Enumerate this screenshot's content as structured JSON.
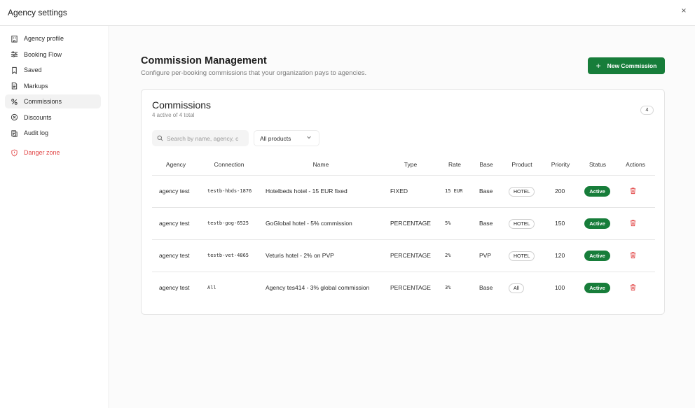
{
  "window": {
    "title": "Agency settings",
    "close_label": "×"
  },
  "sidebar": {
    "items": [
      {
        "label": "Agency profile",
        "icon": "building-icon"
      },
      {
        "label": "Booking Flow",
        "icon": "sliders-icon"
      },
      {
        "label": "Saved",
        "icon": "bookmark-icon"
      },
      {
        "label": "Markups",
        "icon": "document-icon"
      },
      {
        "label": "Commissions",
        "icon": "handshake-icon",
        "active": true
      },
      {
        "label": "Discounts",
        "icon": "circle-x-icon"
      },
      {
        "label": "Audit log",
        "icon": "log-icon"
      }
    ],
    "danger": {
      "label": "Danger zone",
      "icon": "shield-icon"
    }
  },
  "header": {
    "title": "Commission Management",
    "subtitle": "Configure per-booking commissions that your organization pays to agencies.",
    "new_button": "New Commission",
    "new_button_icon": "+"
  },
  "card": {
    "title": "Commissions",
    "subtitle": "4 active of 4 total",
    "count": "4",
    "search_placeholder": "Search by name, agency, c",
    "product_filter": "All products"
  },
  "table": {
    "columns": [
      "Agency",
      "Connection",
      "Name",
      "Type",
      "Rate",
      "Base",
      "Product",
      "Priority",
      "Status",
      "Actions"
    ],
    "rows": [
      {
        "agency": "agency test",
        "connection": "testb-hbds-1876",
        "name": "Hotelbeds hotel - 15 EUR fixed",
        "type": "FIXED",
        "rate": "15 EUR",
        "base": "Base",
        "product": "HOTEL",
        "priority": "200",
        "status": "Active"
      },
      {
        "agency": "agency test",
        "connection": "testb-gog-6525",
        "name": "GoGlobal hotel - 5% commission",
        "type": "PERCENTAGE",
        "rate": "5%",
        "base": "Base",
        "product": "HOTEL",
        "priority": "150",
        "status": "Active"
      },
      {
        "agency": "agency test",
        "connection": "testb-vet-4865",
        "name": "Veturis hotel - 2% on PVP",
        "type": "PERCENTAGE",
        "rate": "2%",
        "base": "PVP",
        "product": "HOTEL",
        "priority": "120",
        "status": "Active"
      },
      {
        "agency": "agency test",
        "connection": "All",
        "name": "Agency tes414 - 3% global commission",
        "type": "PERCENTAGE",
        "rate": "3%",
        "base": "Base",
        "product": "All",
        "priority": "100",
        "status": "Active"
      }
    ]
  },
  "colors": {
    "accent": "#177d3a",
    "danger": "#e24a4a"
  }
}
